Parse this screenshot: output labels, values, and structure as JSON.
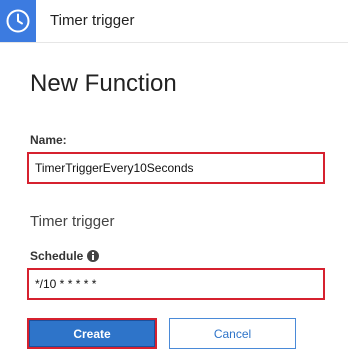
{
  "header": {
    "title": "Timer trigger",
    "icon": "clock-icon",
    "icon_bg": "#3c7be0"
  },
  "form": {
    "title": "New Function",
    "name": {
      "label": "Name:",
      "value": "TimerTriggerEvery10Seconds"
    },
    "section_title": "Timer trigger",
    "schedule": {
      "label": "Schedule",
      "info_icon": "info-icon",
      "value": "*/10 * * * * *"
    }
  },
  "buttons": {
    "create_label": "Create",
    "cancel_label": "Cancel"
  },
  "colors": {
    "primary": "#2e74c9",
    "highlight": "#d6212f"
  }
}
